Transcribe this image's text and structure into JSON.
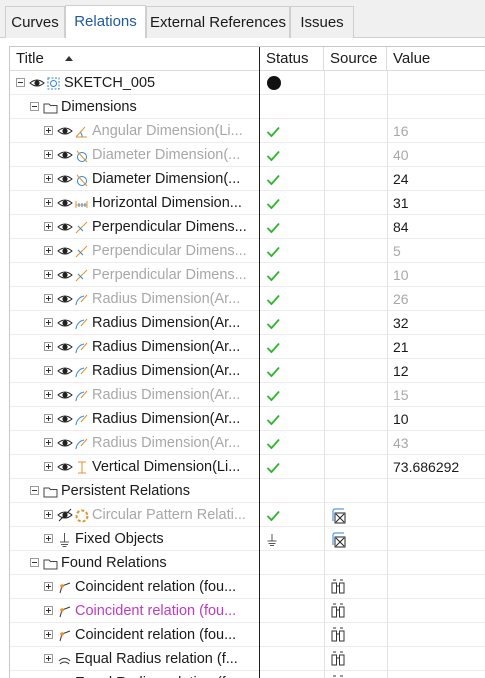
{
  "tabs": [
    {
      "label": "Curves",
      "active": false
    },
    {
      "label": "Relations",
      "active": true
    },
    {
      "label": "External References",
      "active": false
    },
    {
      "label": "Issues",
      "active": false
    }
  ],
  "columns": {
    "title": "Title",
    "status": "Status",
    "source": "Source",
    "value": "Value"
  },
  "rows": [
    {
      "level": 0,
      "expander": "minus",
      "eye": true,
      "icon": "sketch-icon",
      "label": "SKETCH_005",
      "dim": false,
      "status": "dot",
      "source": "",
      "value": ""
    },
    {
      "level": 1,
      "expander": "minus",
      "eye": false,
      "icon": "folder-icon",
      "label": "Dimensions",
      "dim": false,
      "status": "",
      "source": "",
      "value": ""
    },
    {
      "level": 2,
      "expander": "plus",
      "eye": true,
      "icon": "angular-dimension-icon",
      "label": "Angular Dimension(Li...",
      "dim": true,
      "status": "check",
      "source": "",
      "value": "16"
    },
    {
      "level": 2,
      "expander": "plus",
      "eye": true,
      "icon": "diameter-dimension-icon",
      "label": "Diameter Dimension(...",
      "dim": true,
      "status": "check",
      "source": "",
      "value": "40"
    },
    {
      "level": 2,
      "expander": "plus",
      "eye": true,
      "icon": "diameter-dimension-icon",
      "label": "Diameter Dimension(...",
      "dim": false,
      "status": "check",
      "source": "",
      "value": "24"
    },
    {
      "level": 2,
      "expander": "plus",
      "eye": true,
      "icon": "horizontal-dimension-icon",
      "label": "Horizontal Dimension...",
      "dim": false,
      "status": "check",
      "source": "",
      "value": "31"
    },
    {
      "level": 2,
      "expander": "plus",
      "eye": true,
      "icon": "perpendicular-dimension-icon",
      "label": "Perpendicular Dimens...",
      "dim": false,
      "status": "check",
      "source": "",
      "value": "84"
    },
    {
      "level": 2,
      "expander": "plus",
      "eye": true,
      "icon": "perpendicular-dimension-icon",
      "label": "Perpendicular Dimens...",
      "dim": true,
      "status": "check",
      "source": "",
      "value": "5"
    },
    {
      "level": 2,
      "expander": "plus",
      "eye": true,
      "icon": "perpendicular-dimension-icon",
      "label": "Perpendicular Dimens...",
      "dim": true,
      "status": "check",
      "source": "",
      "value": "10"
    },
    {
      "level": 2,
      "expander": "plus",
      "eye": true,
      "icon": "radius-dimension-icon",
      "label": "Radius Dimension(Ar...",
      "dim": true,
      "status": "check",
      "source": "",
      "value": "26"
    },
    {
      "level": 2,
      "expander": "plus",
      "eye": true,
      "icon": "radius-dimension-icon",
      "label": "Radius Dimension(Ar...",
      "dim": false,
      "status": "check",
      "source": "",
      "value": "32"
    },
    {
      "level": 2,
      "expander": "plus",
      "eye": true,
      "icon": "radius-dimension-icon",
      "label": "Radius Dimension(Ar...",
      "dim": false,
      "status": "check",
      "source": "",
      "value": "21"
    },
    {
      "level": 2,
      "expander": "plus",
      "eye": true,
      "icon": "radius-dimension-icon",
      "label": "Radius Dimension(Ar...",
      "dim": false,
      "status": "check",
      "source": "",
      "value": "12"
    },
    {
      "level": 2,
      "expander": "plus",
      "eye": true,
      "icon": "radius-dimension-icon",
      "label": "Radius Dimension(Ar...",
      "dim": true,
      "status": "check",
      "source": "",
      "value": "15"
    },
    {
      "level": 2,
      "expander": "plus",
      "eye": true,
      "icon": "radius-dimension-icon",
      "label": "Radius Dimension(Ar...",
      "dim": false,
      "status": "check",
      "source": "",
      "value": "10"
    },
    {
      "level": 2,
      "expander": "plus",
      "eye": true,
      "icon": "radius-dimension-icon",
      "label": "Radius Dimension(Ar...",
      "dim": true,
      "status": "check",
      "source": "",
      "value": "43"
    },
    {
      "level": 2,
      "expander": "plus",
      "eye": true,
      "icon": "vertical-dimension-icon",
      "label": "Vertical Dimension(Li...",
      "dim": false,
      "status": "check",
      "source": "",
      "value": "73.686292"
    },
    {
      "level": 1,
      "expander": "minus",
      "eye": false,
      "icon": "folder-icon",
      "label": "Persistent Relations",
      "dim": false,
      "status": "",
      "source": "",
      "value": ""
    },
    {
      "level": 2,
      "expander": "plus",
      "eye": "hidden",
      "icon": "circular-pattern-icon",
      "label": "Circular Pattern Relati...",
      "dim": true,
      "status": "check",
      "source": "relation-source-icon",
      "value": ""
    },
    {
      "level": 2,
      "expander": "plus",
      "eye": false,
      "icon": "fixed-icon",
      "label": "Fixed Objects",
      "dim": false,
      "status": "fixed",
      "source": "relation-source-icon",
      "value": ""
    },
    {
      "level": 1,
      "expander": "minus",
      "eye": false,
      "icon": "folder-icon",
      "label": "Found Relations",
      "dim": false,
      "status": "",
      "source": "",
      "value": ""
    },
    {
      "level": 2,
      "expander": "plus",
      "eye": false,
      "icon": "coincident-icon",
      "label": "Coincident relation (fou...",
      "dim": false,
      "status": "",
      "source": "binoculars-icon",
      "value": ""
    },
    {
      "level": 2,
      "expander": "plus",
      "eye": false,
      "icon": "coincident-icon",
      "label": "Coincident relation (fou...",
      "dim": false,
      "magenta": true,
      "status": "",
      "source": "binoculars-icon",
      "value": ""
    },
    {
      "level": 2,
      "expander": "plus",
      "eye": false,
      "icon": "coincident-icon",
      "label": "Coincident relation (fou...",
      "dim": false,
      "status": "",
      "source": "binoculars-icon",
      "value": ""
    },
    {
      "level": 2,
      "expander": "plus",
      "eye": false,
      "icon": "equal-radius-icon",
      "label": "Equal Radius relation (f...",
      "dim": false,
      "status": "",
      "source": "binoculars-icon",
      "value": ""
    },
    {
      "level": 2,
      "expander": "plus",
      "eye": false,
      "icon": "equal-radius-icon",
      "label": "Equal Radius relation (f...",
      "dim": false,
      "status": "",
      "source": "binoculars-icon",
      "value": ""
    }
  ],
  "colors": {
    "check": "#2fb52f",
    "accent_blue": "#2d86d6",
    "orange": "#e8902a",
    "magenta": "#c03ac0",
    "dim_text": "#a8a8a8"
  }
}
